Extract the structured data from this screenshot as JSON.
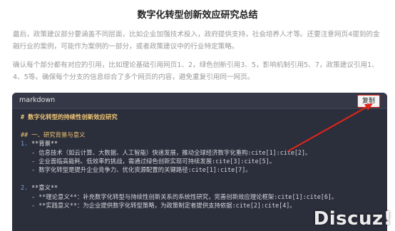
{
  "page_title": "数字化转型创新效应研究总结",
  "paragraph_1": "最后，政策建议部分要涵盖不同层面，比如企业加强技术投入，政府提供支持，社会培养人才等。还要注意网页4提到的金融行业的案例，可能作为案例的一部分，或者政策建议中的行业特定策略。",
  "paragraph_2": "确认每个部分都有对应的引用，比如理论基础引用网页1、2，绿色创新引用3、5，影响机制引用5、7，政策建议引用1、4、5等。确保每个分支的信息综合了多个网页的内容，避免重复引用同一网页。",
  "code_block": {
    "language": "markdown",
    "copy_label": "复制",
    "lines": [
      {
        "segments": [
          {
            "t": "# 数字化转型的持续性创新效应研究",
            "c": "h1"
          }
        ]
      },
      {
        "segments": [
          {
            "t": " ",
            "c": ""
          }
        ]
      },
      {
        "segments": [
          {
            "t": "## 一、研究背景与意义",
            "c": "h2"
          }
        ]
      },
      {
        "segments": [
          {
            "t": "1.",
            "c": "num"
          },
          {
            "t": " **背景**",
            "c": "bold"
          }
        ]
      },
      {
        "segments": [
          {
            "t": "   - 信息技术（如云计算、大数据、人工智能）快速发展，推动全球经济数字化重构:cite[1]:cite[2]。",
            "c": ""
          }
        ]
      },
      {
        "segments": [
          {
            "t": "   - 企业面临高能耗、低效率的挑战，需通过绿色创新实现可持续发展:cite[3]:cite[5]。",
            "c": ""
          }
        ]
      },
      {
        "segments": [
          {
            "t": "   - 数字化转型是提升企业竞争力、优化资源配置的关键路径:cite[1]:cite[7]。",
            "c": ""
          }
        ]
      },
      {
        "segments": [
          {
            "t": " ",
            "c": ""
          }
        ]
      },
      {
        "segments": [
          {
            "t": "2.",
            "c": "num"
          },
          {
            "t": " **意义**",
            "c": "bold"
          }
        ]
      },
      {
        "segments": [
          {
            "t": "   - **理论意义**：补充数字化转型与持续性创新关系的系统性研究，完善创新效应理论框架:cite[1]:cite[6]。",
            "c": ""
          }
        ]
      },
      {
        "segments": [
          {
            "t": "   - **实践意义**：为企业提供数字化转型策略，为政策制定者提供支持依据:cite[2]:cite[4]。",
            "c": ""
          }
        ]
      }
    ]
  },
  "watermark": "Discuz!",
  "colors": {
    "background": "#ffffff",
    "code_bg": "#2b2e3b",
    "heading": "#f0c674",
    "highlight_red": "#e1251b"
  }
}
